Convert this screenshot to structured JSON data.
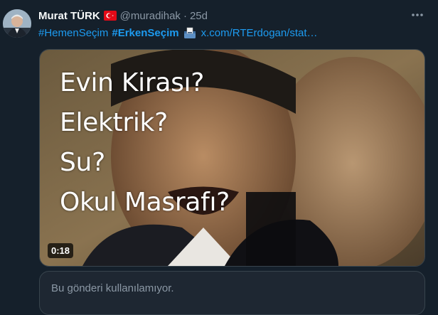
{
  "tweet": {
    "author_name": "Murat TÜRK",
    "handle": "@muradihak",
    "separator": "·",
    "timestamp": "25d",
    "hashtag_1": "#HemenSeçim",
    "hashtag_2": "#ErkenSeçim",
    "link": "x.com/RTErdogan/stat…",
    "media": {
      "caption_lines": [
        "Evin Kirası?",
        "Elektrik?",
        "Su?",
        "Okul Masrafı?"
      ],
      "duration": "0:18"
    },
    "quote_unavailable": "Bu gönderi kullanılamıyor."
  },
  "icons": {
    "more": "more-icon",
    "flag": "turkey-flag-icon",
    "ballot": "ballot-box-icon"
  },
  "colors": {
    "background": "#15202b",
    "accent": "#1d9bf0",
    "muted": "#8b98a5"
  }
}
